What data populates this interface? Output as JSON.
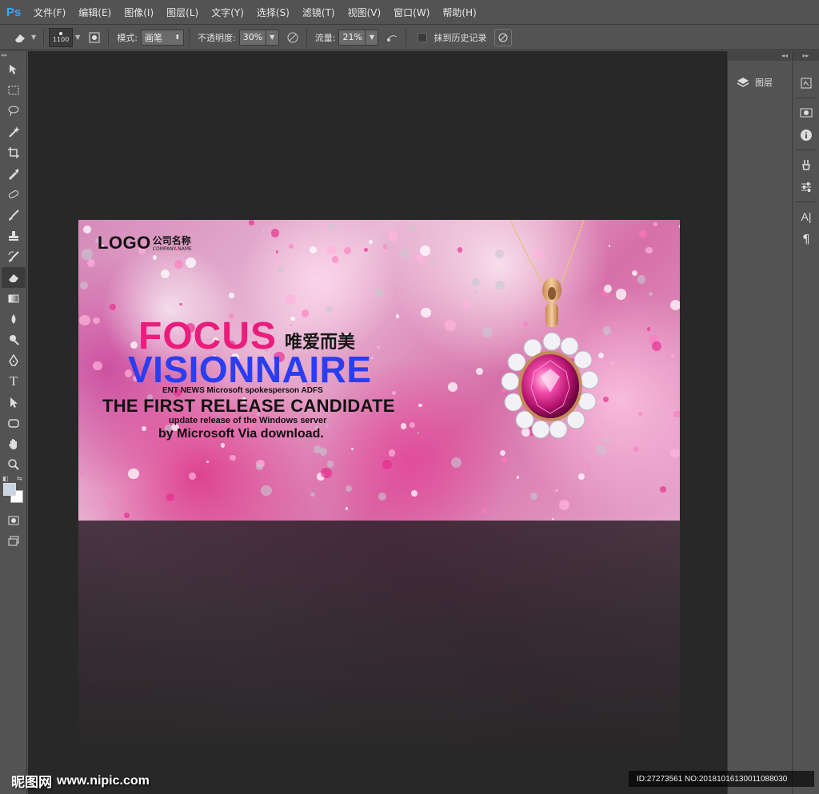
{
  "app": {
    "logo": "Ps"
  },
  "menu": [
    "文件(F)",
    "编辑(E)",
    "图像(I)",
    "图层(L)",
    "文字(Y)",
    "选择(S)",
    "滤镜(T)",
    "视图(V)",
    "窗口(W)",
    "帮助(H)"
  ],
  "options": {
    "brush_size": "1100",
    "mode_label": "模式:",
    "mode_value": "画笔",
    "opacity_label": "不透明度:",
    "opacity_value": "30%",
    "flow_label": "流量:",
    "flow_value": "21%",
    "history_label": "抹到历史记录"
  },
  "tools": [
    "move-tool",
    "marquee-tool",
    "lasso-tool",
    "magic-wand-tool",
    "crop-tool",
    "eyedropper-tool",
    "healing-brush-tool",
    "brush-tool",
    "clone-stamp-tool",
    "history-brush-tool",
    "eraser-tool",
    "gradient-tool",
    "blur-tool",
    "dodge-tool",
    "pen-tool",
    "type-tool",
    "path-selection-tool",
    "shape-tool",
    "hand-tool",
    "zoom-tool"
  ],
  "colors": {
    "foreground": "#c9d4e4",
    "background": "#ffffff",
    "canvas_bg": "#282828",
    "ui_bg": "#535353",
    "focus_pink": "#ea1c7c",
    "visionnaire_blue": "#2a3ef0"
  },
  "panels": {
    "layers_label": "图层"
  },
  "banner": {
    "logo": "LOGO",
    "company_cn": "公司名称",
    "company_en": "COMPANY NAME",
    "focus": "FOCUS",
    "slogan_cn": "唯爱而美",
    "visionnaire": "VISIONNAIRE",
    "line1": "ENT NEWS Microsoft spokesperson ADFS",
    "line2": "THE FIRST RELEASE CANDIDATE",
    "line3": "update release of the Windows server",
    "line4": "by Microsoft Via download."
  },
  "watermark": {
    "site_cn": "昵图网",
    "site_url": "www.nipic.com",
    "id_text": "ID:27273561 NO:20181016130011088030"
  }
}
